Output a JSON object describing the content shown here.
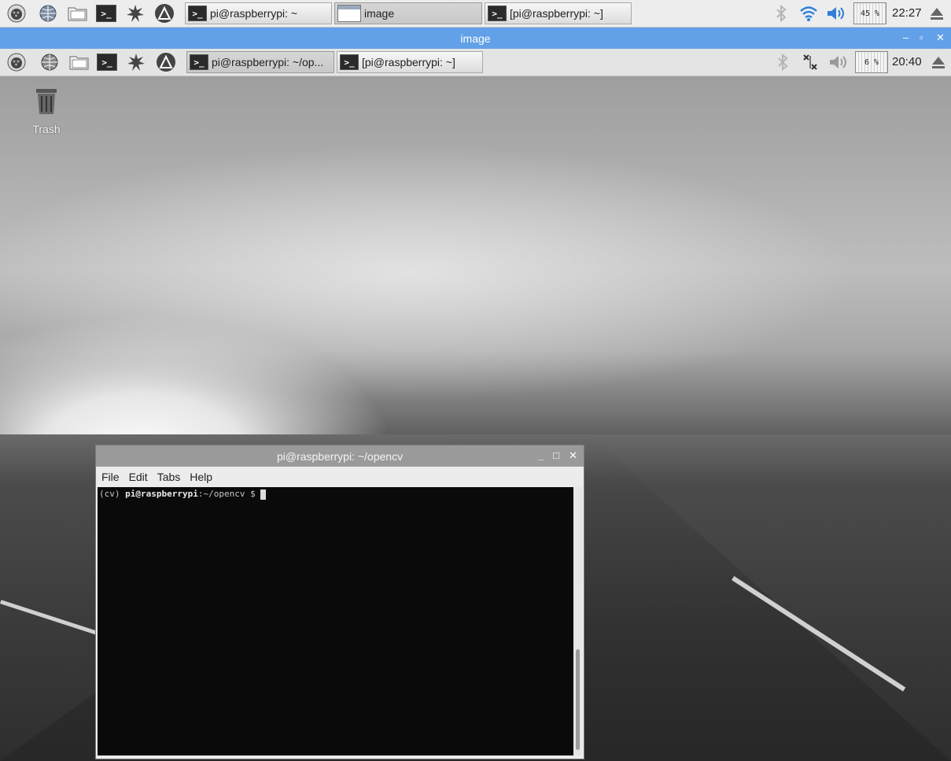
{
  "host_taskbar": {
    "launchers": [
      "raspberry-menu-icon",
      "web-browser-icon",
      "file-manager-icon",
      "terminal-icon",
      "math-kernel-icon",
      "wolfram-icon"
    ],
    "tasks": [
      {
        "label": "pi@raspberrypi: ~",
        "icon": "terminal"
      },
      {
        "label": "image",
        "icon": "window",
        "active": true
      },
      {
        "label": "[pi@raspberrypi: ~]",
        "icon": "terminal"
      }
    ],
    "cpu_percent": "45 %",
    "clock": "22:27"
  },
  "viewer": {
    "title": "image",
    "controls": {
      "minimize": "–",
      "maximize": "▫",
      "close": "✕"
    }
  },
  "guest_taskbar": {
    "tasks": [
      {
        "label": "pi@raspberrypi: ~/op...",
        "icon": "terminal",
        "active": true
      },
      {
        "label": "[pi@raspberrypi: ~]",
        "icon": "terminal"
      }
    ],
    "cpu_percent": "6 %",
    "clock": "20:40"
  },
  "desktop": {
    "trash_label": "Trash"
  },
  "terminal": {
    "title": "pi@raspberrypi: ~/opencv",
    "controls": {
      "minimize": "_",
      "maximize": "□",
      "close": "✕"
    },
    "menu": [
      "File",
      "Edit",
      "Tabs",
      "Help"
    ],
    "prompt_env": "(cv)",
    "prompt_user": "pi@raspberrypi",
    "prompt_path": ":~/opencv $"
  }
}
